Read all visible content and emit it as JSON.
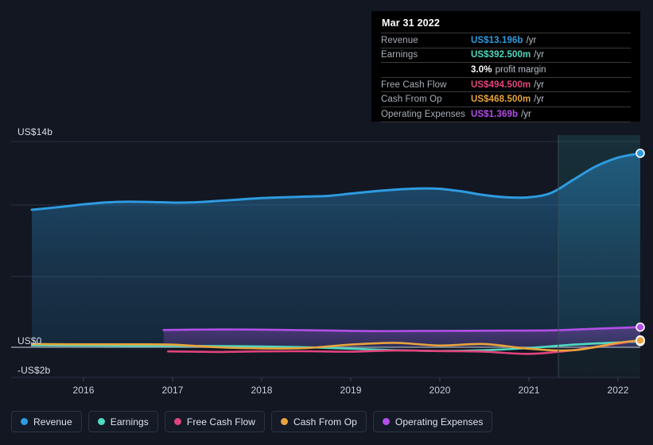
{
  "chart_data": {
    "type": "area",
    "title": "",
    "xlabel": "",
    "ylabel": "",
    "ylim": [
      -2,
      14
    ],
    "y_unit": "US$",
    "grid": true,
    "legend_position": "bottom",
    "y_ticks": [
      {
        "label": "US$14b",
        "value": 14
      },
      {
        "label": "US$0",
        "value": 0
      },
      {
        "label": "-US$2b",
        "value": -2
      }
    ],
    "x_ticks": [
      "2016",
      "2017",
      "2018",
      "2019",
      "2020",
      "2021",
      "2022"
    ],
    "x_range": [
      "2015.4",
      "2022.25"
    ],
    "forecast_divider_x": "2021.33",
    "series": [
      {
        "name": "Revenue",
        "color": "#2E9BE0",
        "x": [
          2015.42,
          2015.75,
          2016.0,
          2016.25,
          2016.5,
          2016.75,
          2017.0,
          2017.25,
          2017.5,
          2017.75,
          2018.0,
          2018.25,
          2018.5,
          2018.75,
          2019.0,
          2019.25,
          2019.5,
          2019.75,
          2020.0,
          2020.25,
          2020.5,
          2020.75,
          2021.0,
          2021.25,
          2021.5,
          2021.75,
          2022.0,
          2022.25
        ],
        "values": [
          9.35,
          9.55,
          9.72,
          9.85,
          9.9,
          9.88,
          9.84,
          9.86,
          9.95,
          10.05,
          10.15,
          10.2,
          10.25,
          10.3,
          10.45,
          10.6,
          10.72,
          10.8,
          10.78,
          10.6,
          10.35,
          10.2,
          10.2,
          10.5,
          11.4,
          12.3,
          12.9,
          13.196
        ]
      },
      {
        "name": "Earnings",
        "color": "#4FD9C0",
        "x": [
          2015.42,
          2016.0,
          2016.5,
          2017.0,
          2017.5,
          2018.0,
          2018.5,
          2019.0,
          2019.5,
          2020.0,
          2020.5,
          2021.0,
          2021.5,
          2022.0,
          2022.25
        ],
        "values": [
          0.13,
          0.12,
          0.1,
          0.09,
          0.08,
          0.05,
          0.0,
          -0.1,
          -0.2,
          -0.25,
          -0.2,
          -0.05,
          0.18,
          0.33,
          0.3925
        ]
      },
      {
        "name": "Free Cash Flow",
        "color": "#E0447C",
        "x": [
          2016.95,
          2017.25,
          2017.5,
          2017.75,
          2018.0,
          2018.5,
          2019.0,
          2019.5,
          2020.0,
          2020.5,
          2021.0,
          2021.5,
          2022.0,
          2022.25
        ],
        "values": [
          -0.28,
          -0.3,
          -0.32,
          -0.3,
          -0.28,
          -0.27,
          -0.3,
          -0.22,
          -0.26,
          -0.3,
          -0.45,
          -0.2,
          0.25,
          0.4945
        ]
      },
      {
        "name": "Cash From Op",
        "color": "#E8A33D",
        "x": [
          2015.42,
          2016.0,
          2016.5,
          2017.0,
          2017.5,
          2018.0,
          2018.5,
          2019.0,
          2019.5,
          2020.0,
          2020.5,
          2021.0,
          2021.5,
          2022.0,
          2022.25
        ],
        "values": [
          0.22,
          0.2,
          0.2,
          0.18,
          0.0,
          -0.08,
          -0.05,
          0.18,
          0.3,
          0.12,
          0.22,
          -0.1,
          -0.2,
          0.3,
          0.4685
        ]
      },
      {
        "name": "Operating Expenses",
        "color": "#B24FE8",
        "x": [
          2016.9,
          2017.25,
          2017.75,
          2018.25,
          2018.75,
          2019.25,
          2019.75,
          2020.25,
          2020.75,
          2021.25,
          2021.75,
          2022.25
        ],
        "values": [
          1.17,
          1.2,
          1.21,
          1.18,
          1.14,
          1.1,
          1.11,
          1.12,
          1.13,
          1.15,
          1.26,
          1.369
        ]
      }
    ],
    "endpoint_markers": true
  },
  "tooltip": {
    "title": "Mar 31 2022",
    "rows": [
      {
        "key": "Revenue",
        "value": "US$13.196b",
        "suffix": "/yr",
        "color": "#2E9BE0",
        "extra": ""
      },
      {
        "key": "Earnings",
        "value": "US$392.500m",
        "suffix": "/yr",
        "color": "#4FD9C0",
        "extra": ""
      },
      {
        "key": "",
        "value": "3.0%",
        "suffix": "",
        "color": "#ffffff",
        "extra": "profit margin"
      },
      {
        "key": "Free Cash Flow",
        "value": "US$494.500m",
        "suffix": "/yr",
        "color": "#E0447C",
        "extra": ""
      },
      {
        "key": "Cash From Op",
        "value": "US$468.500m",
        "suffix": "/yr",
        "color": "#E8A33D",
        "extra": ""
      },
      {
        "key": "Operating Expenses",
        "value": "US$1.369b",
        "suffix": "/yr",
        "color": "#B24FE8",
        "extra": ""
      }
    ]
  },
  "legend": {
    "items": [
      {
        "label": "Revenue",
        "color": "#2E9BE0"
      },
      {
        "label": "Earnings",
        "color": "#4FD9C0"
      },
      {
        "label": "Free Cash Flow",
        "color": "#E0447C"
      },
      {
        "label": "Cash From Op",
        "color": "#E8A33D"
      },
      {
        "label": "Operating Expenses",
        "color": "#B24FE8"
      }
    ]
  },
  "axis": {
    "y_labels": [
      "US$14b",
      "US$0",
      "-US$2b"
    ],
    "x_labels": [
      "2016",
      "2017",
      "2018",
      "2019",
      "2020",
      "2021",
      "2022"
    ]
  }
}
